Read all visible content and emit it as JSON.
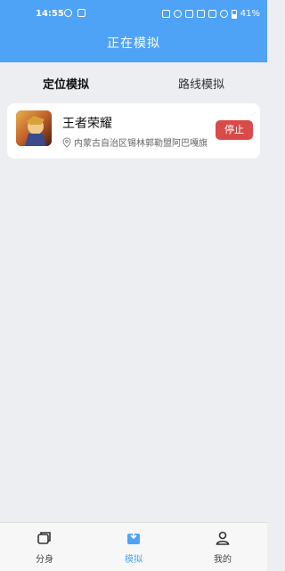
{
  "status_bar": {
    "time": "14:55",
    "battery": "41%"
  },
  "header": {
    "title": "正在模拟"
  },
  "tabs": {
    "active": "定位模拟",
    "inactive": "路线模拟"
  },
  "card": {
    "app_name": "王者荣耀",
    "location": "内蒙古自治区锡林郭勒盟阿巴嘎旗",
    "stop_label": "停止",
    "stop_color": "#d94a4a"
  },
  "bottom_nav": [
    {
      "label": "分身",
      "icon": "clone-icon"
    },
    {
      "label": "模拟",
      "icon": "simulate-icon"
    },
    {
      "label": "我的",
      "icon": "user-icon"
    }
  ],
  "colors": {
    "accent": "#4fa3f7",
    "background": "#eceef2"
  }
}
